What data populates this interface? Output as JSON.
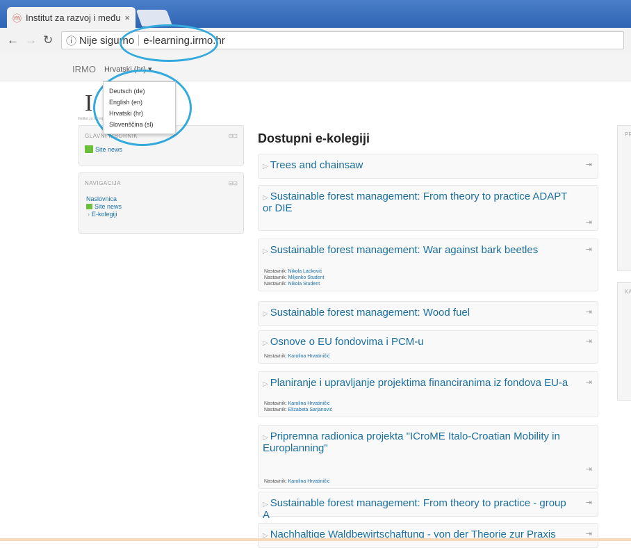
{
  "browser": {
    "tab_title": "Institut za razvoj i među",
    "tab_close": "×",
    "address": {
      "security": "Nije sigurno",
      "url": "e-learning.irmo.hr"
    }
  },
  "navbar": {
    "brand": "IRMO",
    "lang_selected": "Hrvatski (hr) ▾"
  },
  "lang_menu": [
    "Deutsch (de)",
    "English (en)",
    "Hrvatski (hr)",
    "Slovenščina (sl)"
  ],
  "logo": {
    "letter": "I",
    "sub": "Institut za razvoj i međunarodne odnose"
  },
  "blocks": {
    "main_menu": {
      "title": "GLAVNI IZBORNIK",
      "site_news": "Site news"
    },
    "navigation": {
      "title": "NAVIGACIJA",
      "home": "Naslovnica",
      "site_news": "Site news",
      "ecourses": "E-kolegiji"
    }
  },
  "main": {
    "title": "Dostupni e-kolegiji",
    "courses": [
      {
        "title": "Trees and chainsaw",
        "teachers": []
      },
      {
        "title": "Sustainable forest management: From theory to practice ADAPT or DIE",
        "teachers": []
      },
      {
        "title": "Sustainable forest management: War against bark beetles",
        "teachers": [
          {
            "label": "Nastavnik:",
            "name": "Nikola Lacković"
          },
          {
            "label": "Nastavnik:",
            "name": "Miljenko Student"
          },
          {
            "label": "Nastavnik:",
            "name": "Nikola Student"
          }
        ]
      },
      {
        "title": "Sustainable forest management: Wood fuel",
        "teachers": []
      },
      {
        "title": "Osnove o EU fondovima i PCM-u",
        "teachers": [
          {
            "label": "Nastavnik:",
            "name": "Karolina Hrvatiničić"
          }
        ]
      },
      {
        "title": "Planiranje i upravljanje projektima financiranima iz fondova EU-a",
        "teachers": [
          {
            "label": "Nastavnik:",
            "name": "Karolina Hrvatiničić"
          },
          {
            "label": "Nastavnik:",
            "name": "Elizabeta Sarjanović"
          }
        ]
      },
      {
        "title": "Pripremna radionica projekta \"ICroME Italo-Croatian Mobility in Europlanning\"",
        "teachers": [
          {
            "label": "Nastavnik:",
            "name": "Karolina Hrvatiničić"
          }
        ]
      },
      {
        "title": "Sustainable forest management: From theory to practice - group A",
        "teachers": []
      },
      {
        "title": "Nachhaltige Waldbewirtschaftung - von der Theorie zur Praxis",
        "teachers": []
      }
    ]
  },
  "side_blocks": [
    "PR",
    "KA"
  ],
  "icons": {
    "enrol": "enrol-icon",
    "collapse": "collapse-icon"
  },
  "colors": {
    "link": "#1a6f9e",
    "highlight": "#33a9dc",
    "tabstrip": "#2f64b4"
  }
}
